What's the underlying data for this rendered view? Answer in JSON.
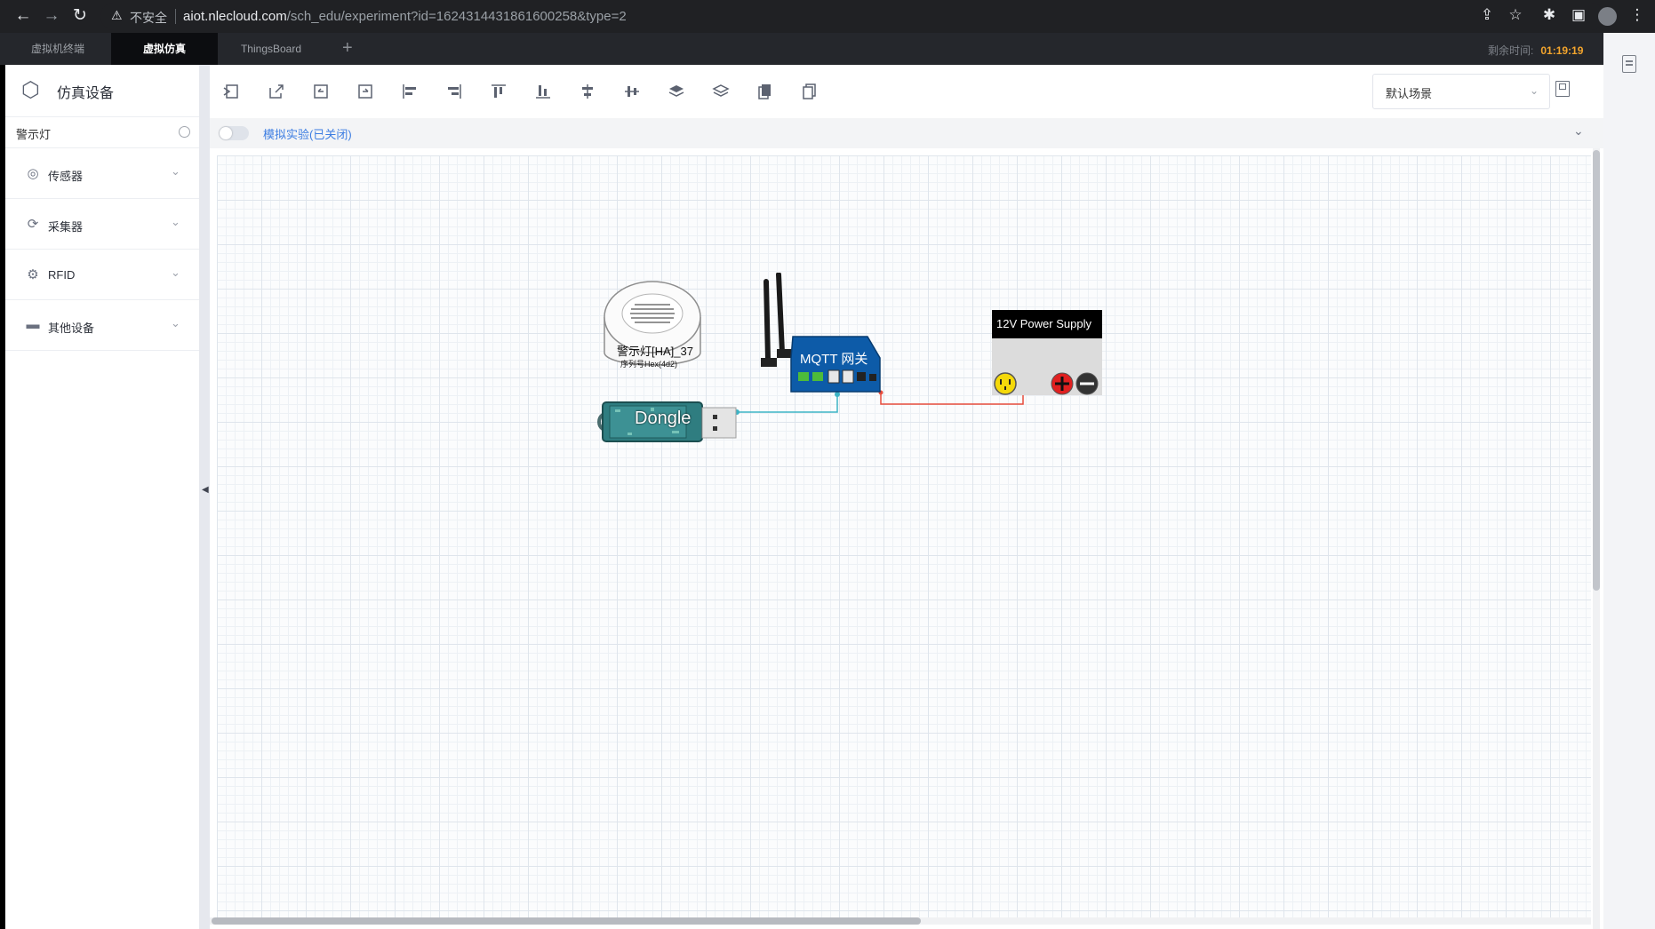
{
  "browser": {
    "insecure_label": "不安全",
    "url_host": "aiot.nlecloud.com",
    "url_path": "/sch_edu/experiment?id=1624314431861600258&type=2"
  },
  "app_tabs": [
    {
      "label": "虚拟机终端",
      "active": false
    },
    {
      "label": "虚拟仿真",
      "active": true
    },
    {
      "label": "ThingsBoard",
      "active": false
    }
  ],
  "add_tab_label": "+",
  "timer": {
    "label": "剩余时间:",
    "value": "01:19:19"
  },
  "sidebar": {
    "title": "仿真设备",
    "search_value": "警示灯",
    "categories": [
      {
        "label": "传感器",
        "icon": "sensor-icon"
      },
      {
        "label": "采集器",
        "icon": "collector-icon"
      },
      {
        "label": "RFID",
        "icon": "gear-icon"
      },
      {
        "label": "其他设备",
        "icon": "device-icon"
      }
    ]
  },
  "toolbar": {
    "scene_select": "默认场景",
    "buttons": [
      "import-icon",
      "export-icon",
      "undo-icon",
      "redo-icon",
      "align-left-icon",
      "align-right-icon",
      "align-top-icon",
      "align-bottom-icon",
      "align-vcenter-icon",
      "align-hcenter-icon",
      "bring-front-icon",
      "send-back-icon",
      "copy-icon",
      "paste-icon"
    ]
  },
  "simulation": {
    "label": "模拟实验(已关闭)",
    "enabled": false
  },
  "canvas": {
    "alarm_light": {
      "name": "警示灯[HA]_37",
      "serial": "序列号Hex(4d2)"
    },
    "gateway": {
      "label": "MQTT 网关"
    },
    "dongle": {
      "label": "Dongle"
    },
    "power_supply": {
      "label": "12V Power Supply"
    }
  },
  "colors": {
    "accent": "#f4a52c",
    "link": "#3c7de2",
    "gateway": "#0d5ba8",
    "dongle": "#2f7d80",
    "wire_data": "#3cb3c5",
    "wire_power": "#e74c3c"
  }
}
